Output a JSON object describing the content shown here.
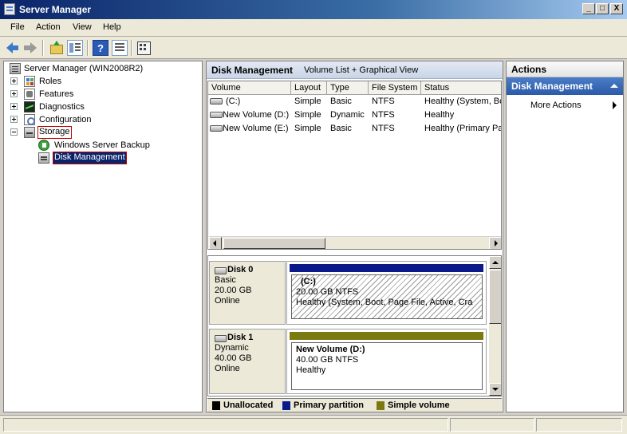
{
  "window": {
    "title": "Server Manager",
    "controls": {
      "minimize": "_",
      "maximize": "□",
      "close": "X"
    }
  },
  "menu": [
    "File",
    "Action",
    "View",
    "Help"
  ],
  "toolbar": {
    "help_glyph": "?"
  },
  "tree": {
    "root": "Server Manager (WIN2008R2)",
    "items": [
      "Roles",
      "Features",
      "Diagnostics",
      "Configuration",
      "Storage"
    ],
    "storage_children": [
      "Windows Server Backup",
      "Disk Management"
    ]
  },
  "center": {
    "title": "Disk Management",
    "subtitle": "Volume List + Graphical View",
    "columns": [
      "Volume",
      "Layout",
      "Type",
      "File System",
      "Status"
    ],
    "rows": [
      {
        "volume": "(C:)",
        "layout": "Simple",
        "type": "Basic",
        "fs": "NTFS",
        "status": "Healthy (System, Bo"
      },
      {
        "volume": "New Volume (D:)",
        "layout": "Simple",
        "type": "Dynamic",
        "fs": "NTFS",
        "status": "Healthy"
      },
      {
        "volume": "New Volume (E:)",
        "layout": "Simple",
        "type": "Basic",
        "fs": "NTFS",
        "status": "Healthy (Primary Par"
      }
    ]
  },
  "disks": [
    {
      "name": "Disk 0",
      "type": "Basic",
      "size": "20.00 GB",
      "state": "Online",
      "bar_color": "#0a1a8a",
      "partition": {
        "name": "(C:)",
        "size_fs": "20.00 GB NTFS",
        "status": "Healthy (System, Boot, Page File, Active, Cra"
      }
    },
    {
      "name": "Disk 1",
      "type": "Dynamic",
      "size": "40.00 GB",
      "state": "Online",
      "bar_color": "#7a7a10",
      "partition": {
        "name": "New Volume  (D:)",
        "size_fs": "40.00 GB NTFS",
        "status": "Healthy"
      }
    }
  ],
  "legend": [
    {
      "label": "Unallocated",
      "color": "#000000"
    },
    {
      "label": "Primary partition",
      "color": "#0a1a8a"
    },
    {
      "label": "Simple volume",
      "color": "#7a7a10"
    }
  ],
  "actions": {
    "header": "Actions",
    "section": "Disk Management",
    "items": [
      "More Actions"
    ]
  }
}
